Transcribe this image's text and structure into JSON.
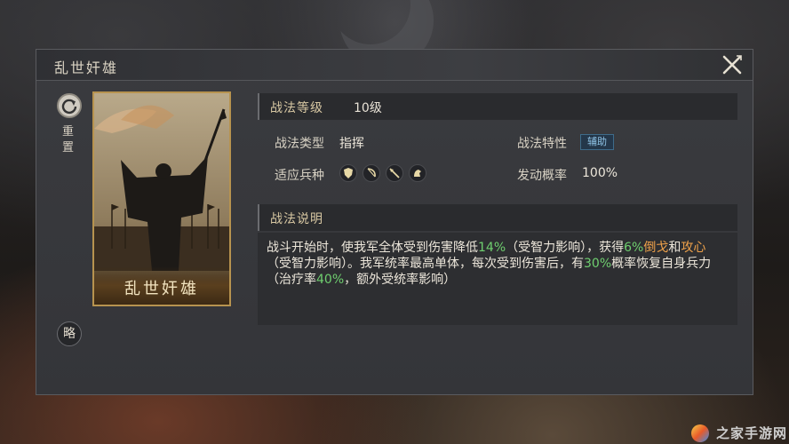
{
  "panel": {
    "title": "乱世奸雄"
  },
  "tools": {
    "reset_label": "重置",
    "brief_label": "略"
  },
  "card": {
    "name": "乱世奸雄"
  },
  "skill": {
    "level_label": "战法等级",
    "level_value": "10级",
    "type_label": "战法类型",
    "type_value": "指挥",
    "trait_label": "战法特性",
    "trait_value": "辅助",
    "troops_label": "适应兵种",
    "troops_icons": [
      "shield-icon",
      "bow-icon",
      "spear-icon",
      "horse-icon"
    ],
    "chance_label": "发动概率",
    "chance_value": "100%"
  },
  "description": {
    "header": "战法说明",
    "parts": [
      "战斗开始时，使我军全体受到伤害降低",
      "14%",
      "（受智力影响），获得",
      "6%",
      "倒戈",
      "和",
      "攻心",
      "（受智力影响）。我军统率最高单体，每次受到伤害后，有",
      "30%",
      "概率恢复自身兵力（治疗率",
      "40%",
      "，额外受统率影响）"
    ]
  },
  "watermark": {
    "text": "之家手游网"
  },
  "colors": {
    "accent_gold": "#b7934f",
    "highlight_green": "#6fcf6f",
    "highlight_orange": "#f0a24a",
    "trait_badge_text": "#8fc3e6"
  }
}
